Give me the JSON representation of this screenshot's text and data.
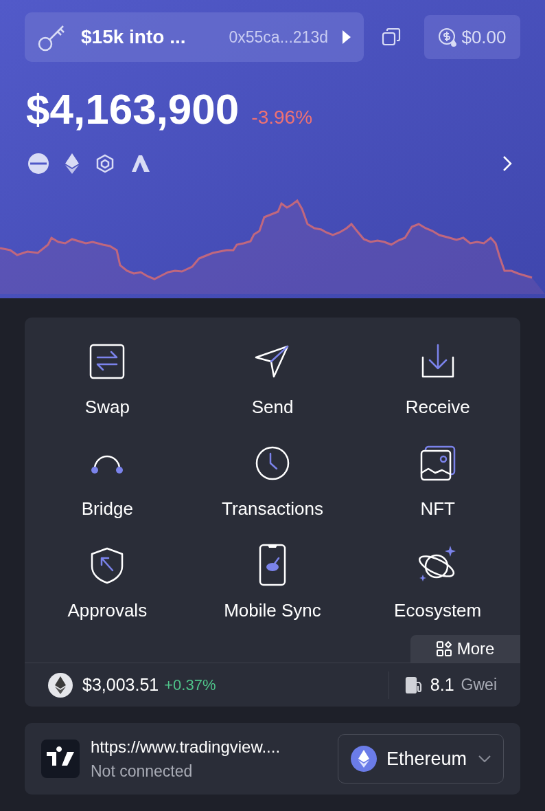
{
  "account": {
    "name": "$15k into ...",
    "address": "0x55ca...213d"
  },
  "gas_balance": "$0.00",
  "balance": {
    "value": "$4,163,900",
    "change": "-3.96%",
    "negative": true
  },
  "chains": [
    {
      "kind": "circle"
    },
    {
      "kind": "ethereum"
    },
    {
      "kind": "cube"
    },
    {
      "kind": "peak"
    }
  ],
  "actions": [
    {
      "kind": "swap",
      "label": "Swap"
    },
    {
      "kind": "send",
      "label": "Send"
    },
    {
      "kind": "receive",
      "label": "Receive"
    },
    {
      "kind": "bridge",
      "label": "Bridge"
    },
    {
      "kind": "transactions",
      "label": "Transactions"
    },
    {
      "kind": "nft",
      "label": "NFT"
    },
    {
      "kind": "approvals",
      "label": "Approvals"
    },
    {
      "kind": "mobile",
      "label": "Mobile Sync"
    },
    {
      "kind": "ecosystem",
      "label": "Ecosystem"
    }
  ],
  "more_button": "More",
  "eth_price": {
    "price": "$3,003.51",
    "change": "+0.37%",
    "negative": false
  },
  "gas": {
    "value": "8.1",
    "unit": "Gwei"
  },
  "site": {
    "url": "https://www.tradingview....",
    "status": "Not connected"
  },
  "network": {
    "name": "Ethereum"
  }
}
